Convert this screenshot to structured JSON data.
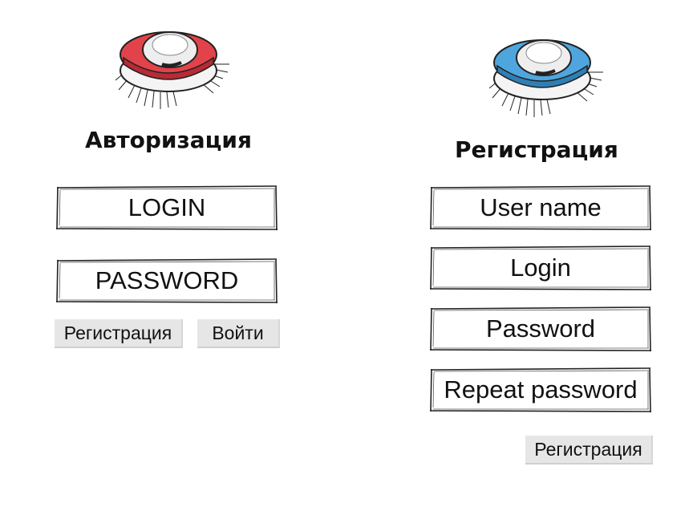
{
  "login_form": {
    "title": "Авторизация",
    "login_placeholder": "LOGIN",
    "password_placeholder": "PASSWORD",
    "register_button": "Регистрация",
    "submit_button": "Войти",
    "robot_color": "#e2434b"
  },
  "register_form": {
    "title": "Регистрация",
    "username_placeholder": "User name",
    "login_placeholder": "Login",
    "password_placeholder": "Password",
    "repeat_password_placeholder": "Repeat password",
    "submit_button": "Регистрация",
    "robot_color": "#4fa6de"
  }
}
